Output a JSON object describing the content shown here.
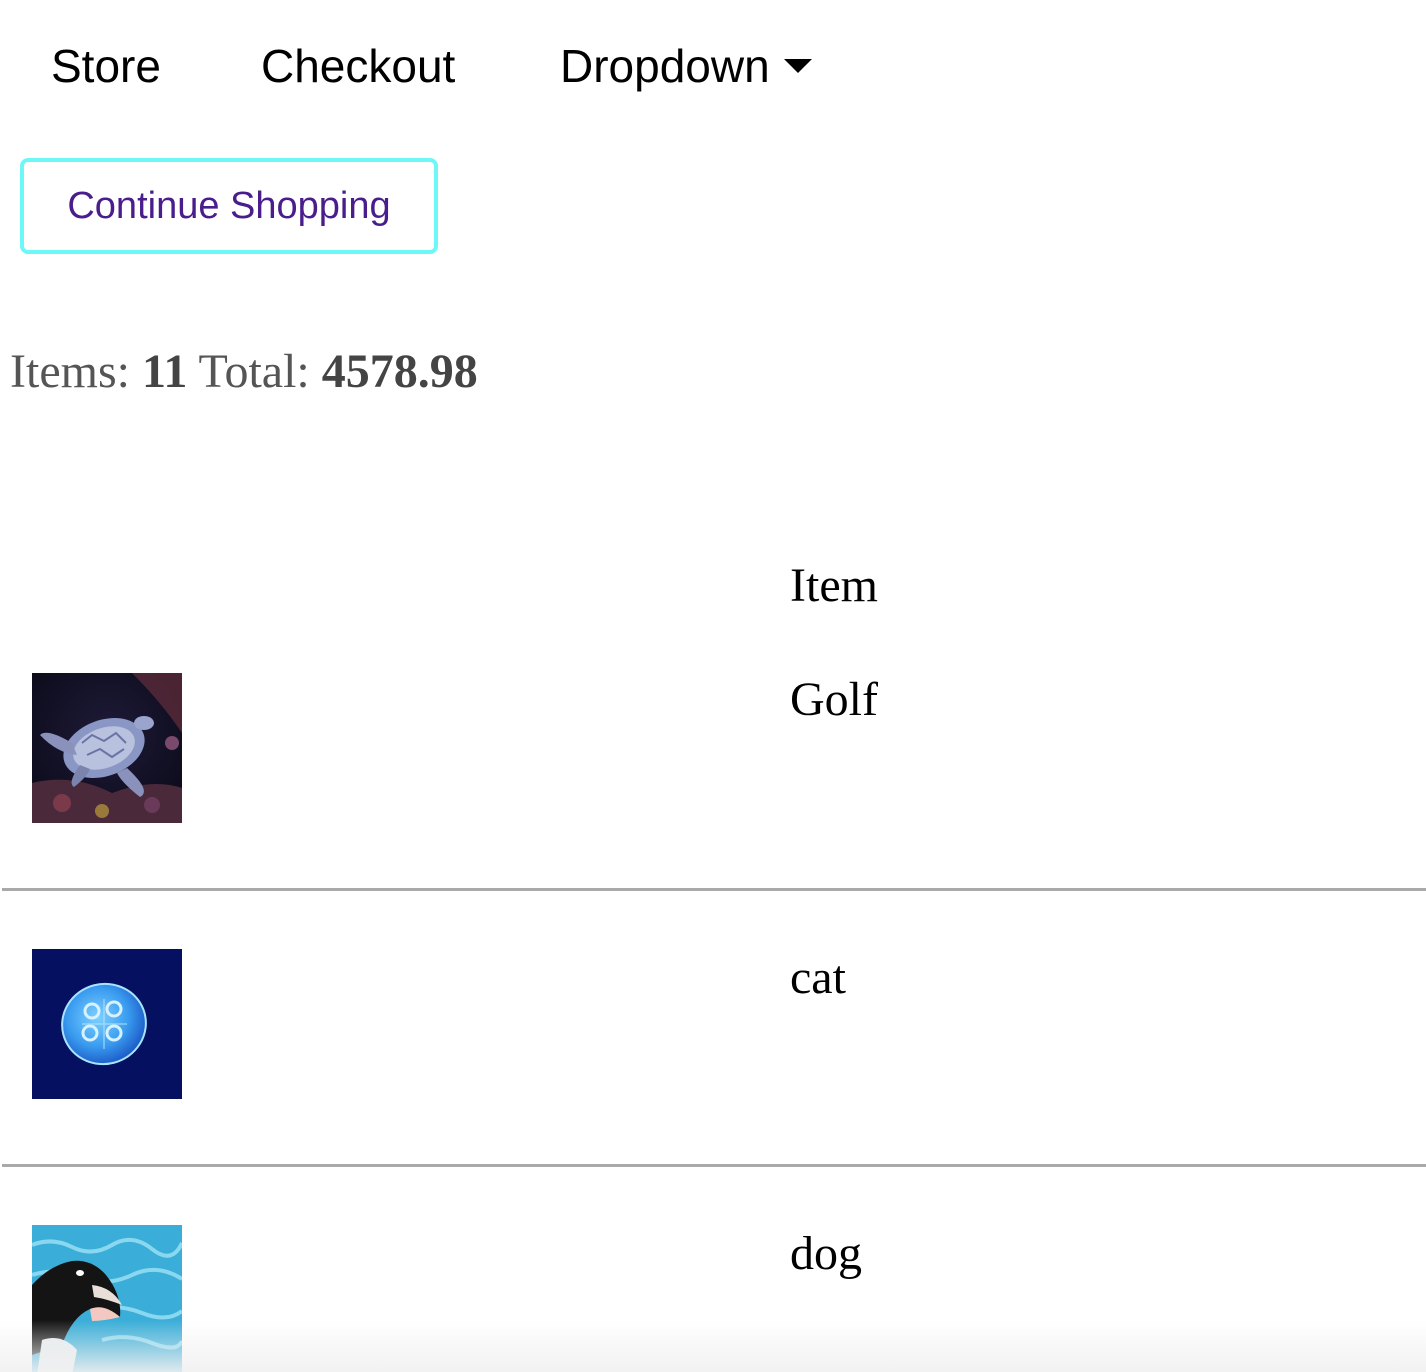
{
  "nav": {
    "store_label": "Store",
    "checkout_label": "Checkout",
    "dropdown_label": "Dropdown"
  },
  "actions": {
    "continue_label": "Continue Shopping"
  },
  "summary": {
    "items_label": "Items:",
    "items_count": "11",
    "total_label": "Total:",
    "total_value": "4578.98"
  },
  "table": {
    "header_item": "Item",
    "rows": [
      {
        "name": "Golf",
        "image": "sea-turtle-image"
      },
      {
        "name": "cat",
        "image": "jellyfish-image"
      },
      {
        "name": "dog",
        "image": "orca-image"
      }
    ]
  },
  "colors": {
    "button_border": "#6ef7f7",
    "button_text": "#4a1d8c",
    "divider": "#a9a9a9"
  }
}
